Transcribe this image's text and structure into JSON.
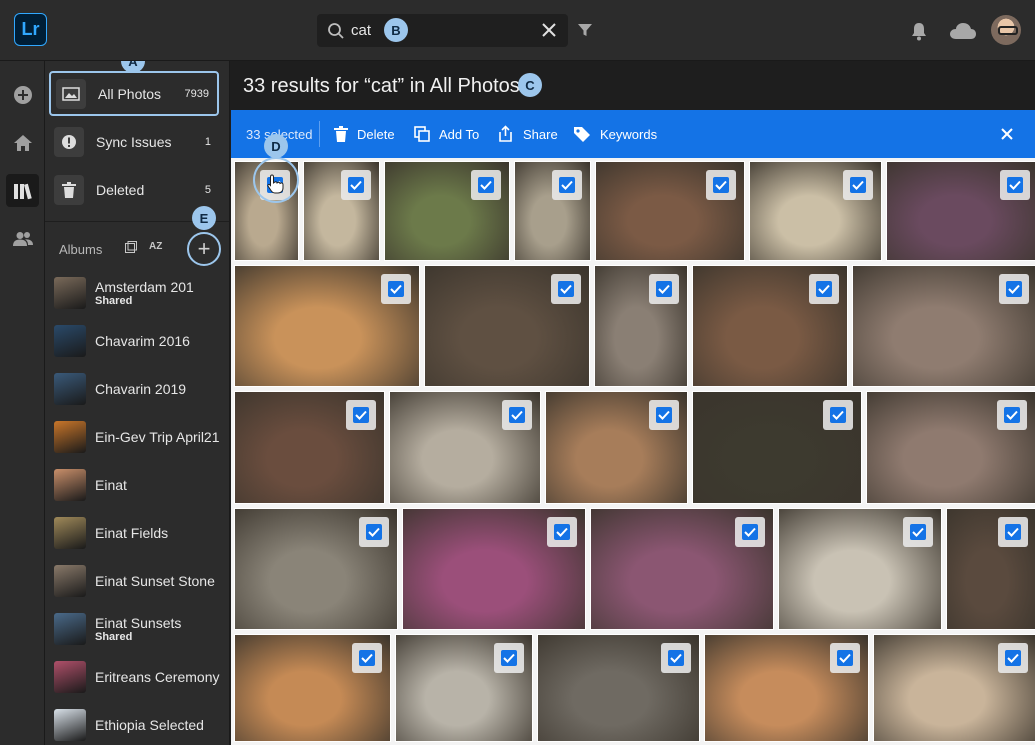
{
  "app": {
    "logo": "Lr"
  },
  "search": {
    "query": "cat",
    "clear_icon": "close-icon",
    "filter_icon": "filter-icon"
  },
  "topbar": {
    "bell_icon": "bell-icon",
    "cloud_icon": "cloud-icon",
    "avatar": "user-avatar"
  },
  "rail": {
    "items": [
      "add-icon",
      "home-icon",
      "library-icon",
      "people-icon"
    ]
  },
  "nav": {
    "all_photos": {
      "label": "All Photos",
      "count": "7939"
    },
    "sync_issues": {
      "label": "Sync Issues",
      "count": "1"
    },
    "deleted": {
      "label": "Deleted",
      "count": "5"
    }
  },
  "albums": {
    "header": "Albums",
    "sort_label": "AZ",
    "add": "+",
    "items": [
      {
        "name": "Amsterdam 201",
        "sub": "Shared"
      },
      {
        "name": "Chavarim 2016",
        "sub": ""
      },
      {
        "name": "Chavarin 2019",
        "sub": ""
      },
      {
        "name": "Ein-Gev Trip April21",
        "sub": ""
      },
      {
        "name": "Einat",
        "sub": ""
      },
      {
        "name": "Einat Fields",
        "sub": ""
      },
      {
        "name": "Einat Sunset Stone",
        "sub": ""
      },
      {
        "name": "Einat Sunsets",
        "sub": "Shared"
      },
      {
        "name": "Eritreans Ceremony",
        "sub": ""
      },
      {
        "name": "Ethiopia Selected",
        "sub": ""
      }
    ]
  },
  "main": {
    "title": "33 results for “cat” in All Photos"
  },
  "selection_bar": {
    "count": "33 selected",
    "delete": "Delete",
    "add_to": "Add To",
    "share": "Share",
    "keywords": "Keywords",
    "color": "#1473e6"
  },
  "callouts": {
    "a": "A",
    "b": "B",
    "c": "C",
    "d": "D",
    "e": "E"
  },
  "photos_selected": 33,
  "photo_rows": [
    {
      "tones": [
        "#b9a98f",
        "#c4b79e",
        "#6c7a4a",
        "#a89f8c",
        "#7b5a45",
        "#cbbfa6",
        "#6a4a5f"
      ]
    },
    {
      "tones": [
        "#c9925a",
        "#5f5042",
        "#8a7f74",
        "#7a5a44",
        "#8f7c70"
      ]
    },
    {
      "tones": [
        "#6a4d3e",
        "#b5ad9f",
        "#a77d5a",
        "#3d3a2f",
        "#8f7a6f"
      ]
    },
    {
      "tones": [
        "#8a8478",
        "#9b4f7a",
        "#8b5672",
        "#c9c2b4",
        "#5a4a3e"
      ]
    },
    {
      "tones": [
        "#c58a55",
        "#b8b3a8",
        "#6f6a62",
        "#c68c5c",
        "#c9b49a"
      ]
    }
  ]
}
